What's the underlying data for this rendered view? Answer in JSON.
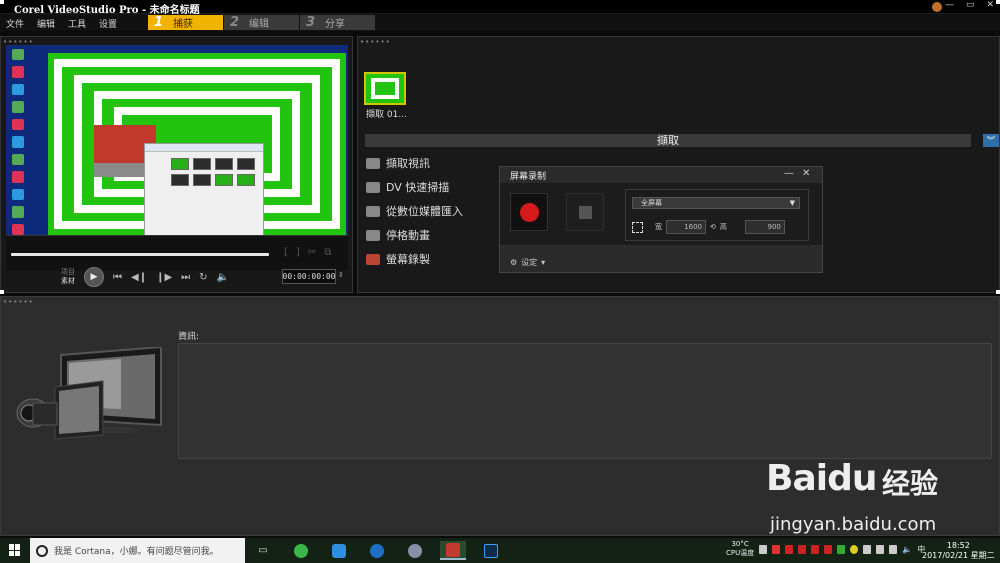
{
  "window": {
    "title": "Corel VideoStudio Pro - 未命名标题",
    "buttons": [
      "—",
      "▭",
      "✕"
    ]
  },
  "menu": [
    "文件",
    "编辑",
    "工具",
    "设置"
  ],
  "steps": [
    {
      "num": "1",
      "label": "捕获",
      "active": true
    },
    {
      "num": "2",
      "label": "编辑",
      "active": false
    },
    {
      "num": "3",
      "label": "分享",
      "active": false
    }
  ],
  "preview": {
    "mode_project": "项目",
    "mode_clip": "素材",
    "timecode": "00:00:00:00",
    "mark_in": "[",
    "mark_out": "]"
  },
  "library": {
    "clip_label": "擷取 01..."
  },
  "capture": {
    "bar_title": "擷取",
    "options": [
      {
        "label": "擷取視訊",
        "icon": "camera-icon"
      },
      {
        "label": "DV 快速掃描",
        "icon": "dv-scan-icon"
      },
      {
        "label": "從數位媒體匯入",
        "icon": "import-disc-icon"
      },
      {
        "label": "停格動畫",
        "icon": "stop-motion-icon"
      },
      {
        "label": "螢幕錄製",
        "icon": "screen-record-icon"
      }
    ]
  },
  "recorder": {
    "title": "屏幕录制",
    "area_option": "全屏幕",
    "width_label": "宽",
    "width_value": "1600",
    "height_label": "高",
    "height_value": "900",
    "settings_label": "设定"
  },
  "info": {
    "label": "資訊:"
  },
  "watermark": {
    "brand": "Baidu",
    "cn": "经验",
    "url": "jingyan.baidu.com"
  },
  "taskbar": {
    "cortana_text": "我是 Cortana，小娜。有问题尽管问我。",
    "cpu_temp": "30°C",
    "cpu_label": "CPU温度",
    "ime": "中",
    "time": "18:52",
    "date": "2017/02/21 星期二"
  },
  "colors": {
    "accent": "#f0b400",
    "record": "#d7191c",
    "taskbar": "#132215"
  }
}
